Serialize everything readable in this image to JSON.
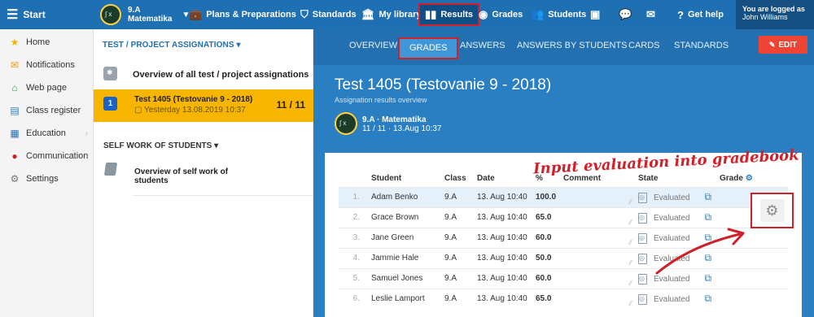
{
  "topbar": {
    "start_label": "Start",
    "class_line1": "9.A",
    "class_line2": "Matematika",
    "nav": [
      {
        "icon": "briefcase-icon",
        "label": "Plans & Preparations"
      },
      {
        "icon": "shield-icon",
        "label": "Standards"
      },
      {
        "icon": "library-icon",
        "label": "My library"
      },
      {
        "icon": "bar-chart-icon",
        "label": "Results"
      },
      {
        "icon": "grades-icon",
        "label": "Grades"
      },
      {
        "icon": "students-icon",
        "label": "Students"
      }
    ],
    "help_label": "Get help",
    "logged_line1": "You are logged as",
    "logged_line2": "John Williams"
  },
  "sidebar": {
    "items": [
      {
        "icon": "star-icon",
        "label": "Home"
      },
      {
        "icon": "envelope-icon",
        "label": "Notifications"
      },
      {
        "icon": "house-icon",
        "label": "Web page"
      },
      {
        "icon": "book-icon",
        "label": "Class register"
      },
      {
        "icon": "education-icon",
        "label": "Education"
      },
      {
        "icon": "chat-icon",
        "label": "Communication"
      },
      {
        "icon": "gear-icon",
        "label": "Settings"
      }
    ]
  },
  "assignments": {
    "title": "TEST / PROJECT ASSIGNATIONS",
    "overview_label": "Overview of all test / project assignations",
    "selected": {
      "badge": "1",
      "title": "Test 1405 (Testovanie 9 - 2018)",
      "subtitle": "Yesterday 13.08.2019 10:37",
      "count": "11 / 11"
    },
    "self_work_title": "SELF WORK OF STUDENTS",
    "self_work_item": "Overview of self work of students"
  },
  "main": {
    "tabs": [
      "OVERVIEW",
      "GRADES",
      "ANSWERS",
      "ANSWERS BY STUDENTS",
      "CARDS",
      "STANDARDS"
    ],
    "edit_label": "EDIT",
    "title": "Test 1405 (Testovanie 9 - 2018)",
    "subtitle": "Assignation results overview",
    "class_line1": "9.A · Matematika",
    "class_line2": "11 / 11 · 13.Aug 10:37"
  },
  "table": {
    "headers": [
      "Student",
      "Class",
      "Date",
      "%",
      "Comment",
      "State",
      "Grade"
    ],
    "rows": [
      {
        "num": "1.",
        "student": "Adam Benko",
        "class": "9.A",
        "date": "13. Aug 10:40",
        "pct": "100.0",
        "state": "Evaluated"
      },
      {
        "num": "2.",
        "student": "Grace Brown",
        "class": "9.A",
        "date": "13. Aug 10:40",
        "pct": "65.0",
        "state": "Evaluated"
      },
      {
        "num": "3.",
        "student": "Jane Green",
        "class": "9.A",
        "date": "13. Aug 10:40",
        "pct": "60.0",
        "state": "Evaluated"
      },
      {
        "num": "4.",
        "student": "Jammie Hale",
        "class": "9.A",
        "date": "13. Aug 10:40",
        "pct": "50.0",
        "state": "Evaluated"
      },
      {
        "num": "5.",
        "student": "Samuel Jones",
        "class": "9.A",
        "date": "13. Aug 10:40",
        "pct": "60.0",
        "state": "Evaluated"
      },
      {
        "num": "6.",
        "student": "Leslie Lamport",
        "class": "9.A",
        "date": "13. Aug 10:40",
        "pct": "65.0",
        "state": "Evaluated"
      }
    ]
  },
  "annotation": "Input evaluation into gradebook",
  "colors": {
    "brand_blue": "#1f6fb3",
    "highlight_red": "#d0202a",
    "selected_yellow": "#f7b500",
    "edit_red": "#ee4433"
  }
}
